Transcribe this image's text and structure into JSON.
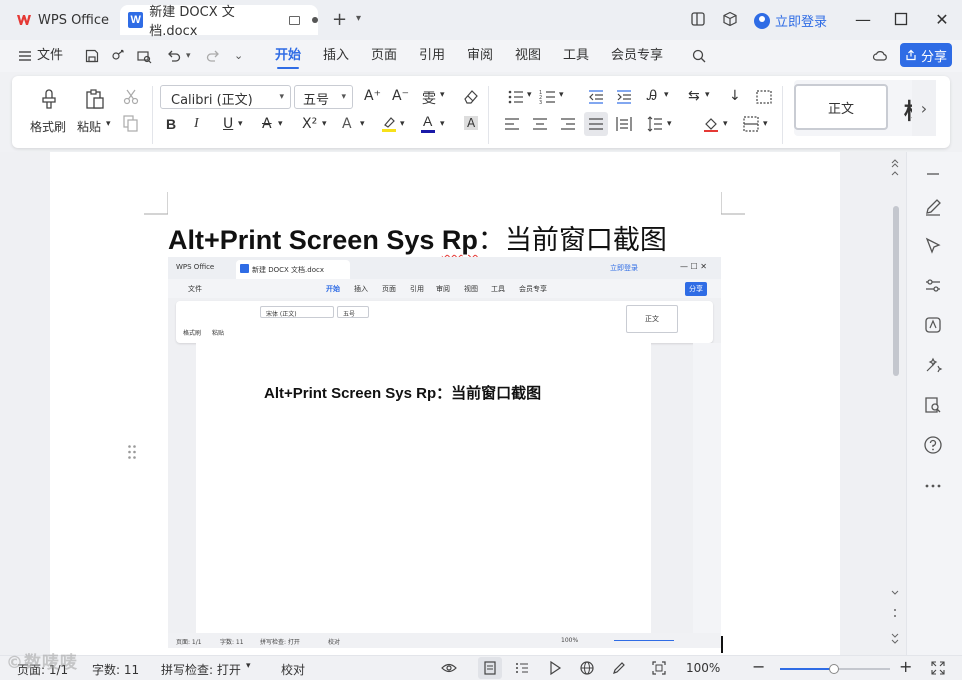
{
  "titlebar": {
    "app_tab": "WPS Office",
    "doc_tab": "新建 DOCX 文档.docx",
    "login": "立即登录"
  },
  "menubar": {
    "file": "文件",
    "tabs": [
      "开始",
      "插入",
      "页面",
      "引用",
      "审阅",
      "视图",
      "工具",
      "会员专享"
    ],
    "active_tab": "开始",
    "share": "分享"
  },
  "ribbon": {
    "format_painter": "格式刷",
    "paste": "粘贴",
    "font_name": "Calibri (正文)",
    "font_size": "五号",
    "style_normal": "正文",
    "style_next_preview": "标"
  },
  "document": {
    "heading_latin": "Alt+Print Screen Sys ",
    "heading_rp": "Rp",
    "heading_cjk": "：当前窗口截图"
  },
  "embedded_screenshot": {
    "app_tab": "WPS Office",
    "doc_tab": "新建 DOCX 文档.docx",
    "login": "立即登录",
    "file": "文件",
    "tabs": [
      "开始",
      "插入",
      "页面",
      "引用",
      "审阅",
      "视图",
      "工具",
      "会员专享"
    ],
    "share": "分享",
    "format_painter": "格式刷",
    "paste": "粘贴",
    "font_name": "宋体 (正文)",
    "font_size": "五号",
    "style_normal": "正文",
    "heading": "Alt+Print Screen Sys Rp：当前窗口截图",
    "status_page": "页面: 1/1",
    "status_words": "字数: 11",
    "status_spell": "拼写检查: 打开",
    "status_proof": "校对",
    "zoom": "100%"
  },
  "statusbar": {
    "page": "页面: 1/1",
    "words": "字数: 11",
    "spell": "拼写检查: 打开",
    "proof": "校对",
    "zoom": "100%",
    "zoom_level": 1.0
  },
  "watermark": "©数唛唛",
  "colors": {
    "accent": "#2f6ce5",
    "wps_red": "#e53935"
  }
}
